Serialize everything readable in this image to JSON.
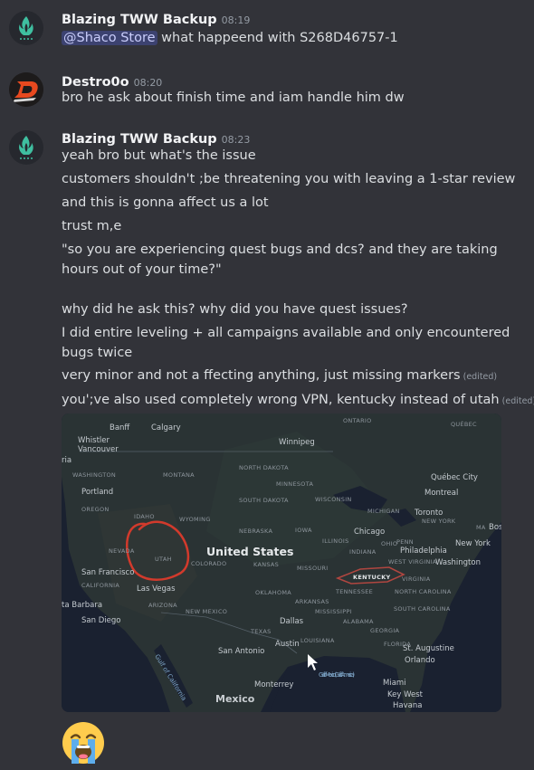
{
  "messages": [
    {
      "author": "Blazing TWW Backup",
      "time": "08:19",
      "mention": "@Shaco Store",
      "lines": [
        "what happeend with S268D46757-1"
      ]
    },
    {
      "author": "Destro0o",
      "time": "08:20",
      "lines": [
        "bro he ask about finish time and iam handle him dw"
      ]
    },
    {
      "author": "Blazing TWW Backup",
      "time": "08:23",
      "lines": [
        "yeah bro but what's the issue",
        "customers shouldn't ;be threatening you with leaving a 1-star review",
        "and this is gonna affect us a lot",
        "trust m,e",
        "\"so you are experiencing quest bugs and dcs? and they are taking hours out of your time?\"",
        "why did he ask this? why did you have quest issues?",
        "I did entire leveling + all campaigns available and only encountered bugs twice",
        "very minor and not a ffecting anything, just missing markers",
        "you';ve also used completely wrong VPN, kentucky instead of utah"
      ],
      "edited_label": "(edited)"
    }
  ],
  "map": {
    "title": "United States",
    "labels": {
      "banff": "Banff",
      "calgary": "Calgary",
      "whistler": "Whistler",
      "vancouver": "Vancouver",
      "ria": "ria",
      "washington_st": "WASHINGTON",
      "portland": "Portland",
      "oregon": "OREGON",
      "montana": "MONTANA",
      "idaho": "IDAHO",
      "wyoming": "WYOMING",
      "nevada": "NEVADA",
      "utah": "UTAH",
      "colorado": "COLORADO",
      "san_francisco": "San Francisco",
      "california": "CALIFORNIA",
      "las_vegas": "Las Vegas",
      "arizona": "ARIZONA",
      "new_mexico": "NEW MEXICO",
      "barbara": "ta Barbara",
      "san_diego": "San Diego",
      "gulf_california": "Gulf of California",
      "north_dakota": "NORTH DAKOTA",
      "south_dakota": "SOUTH DAKOTA",
      "nebraska": "NEBRASKA",
      "kansas": "KANSAS",
      "oklahoma": "OKLAHOMA",
      "texas": "TEXAS",
      "winnipeg": "Winnipeg",
      "minnesota": "MINNESOTA",
      "wisconsin": "WISCONSIN",
      "iowa": "IOWA",
      "illinois": "ILLINOIS",
      "missouri": "MISSOURI",
      "arkansas": "ARKANSAS",
      "mississippi": "MISSISSIPPI",
      "louisiana": "LOUISIANA",
      "chicago": "Chicago",
      "michigan": "MICHIGAN",
      "indiana": "INDIANA",
      "ohio": "OHIO",
      "kentucky": "KENTUCKY",
      "tennessee": "TENNESSEE",
      "alabama": "ALABAMA",
      "georgia": "GEORGIA",
      "florida": "FLORIDA",
      "dallas": "Dallas",
      "austin": "Austin",
      "san_antonio": "San Antonio",
      "monterrey": "Monterrey",
      "gulf_mexico": "Gulf of Mexico (Gulf of America)",
      "mexico": "Mexico",
      "ontario": "ONTARIO",
      "quebec": "QUÉBEC",
      "quebec_city": "Québec City",
      "montreal": "Montreal",
      "toronto": "Toronto",
      "new_york_st": "NEW YORK",
      "ma": "MA",
      "boston": "Bost",
      "new_york": "New York",
      "penn": "PENN",
      "philadelphia": "Philadelphia",
      "washington_dc": "Washington",
      "west_virginia": "WEST VIRGINIA",
      "virginia": "VIRGINIA",
      "north_carolina": "NORTH CAROLINA",
      "south_carolina": "SOUTH CAROLINA",
      "st_augustine": "St. Augustine",
      "orlando": "Orlando",
      "miami": "Miami",
      "key_west": "Key West",
      "havana": "Havana"
    }
  },
  "reaction_emoji": "loudly-crying-face"
}
